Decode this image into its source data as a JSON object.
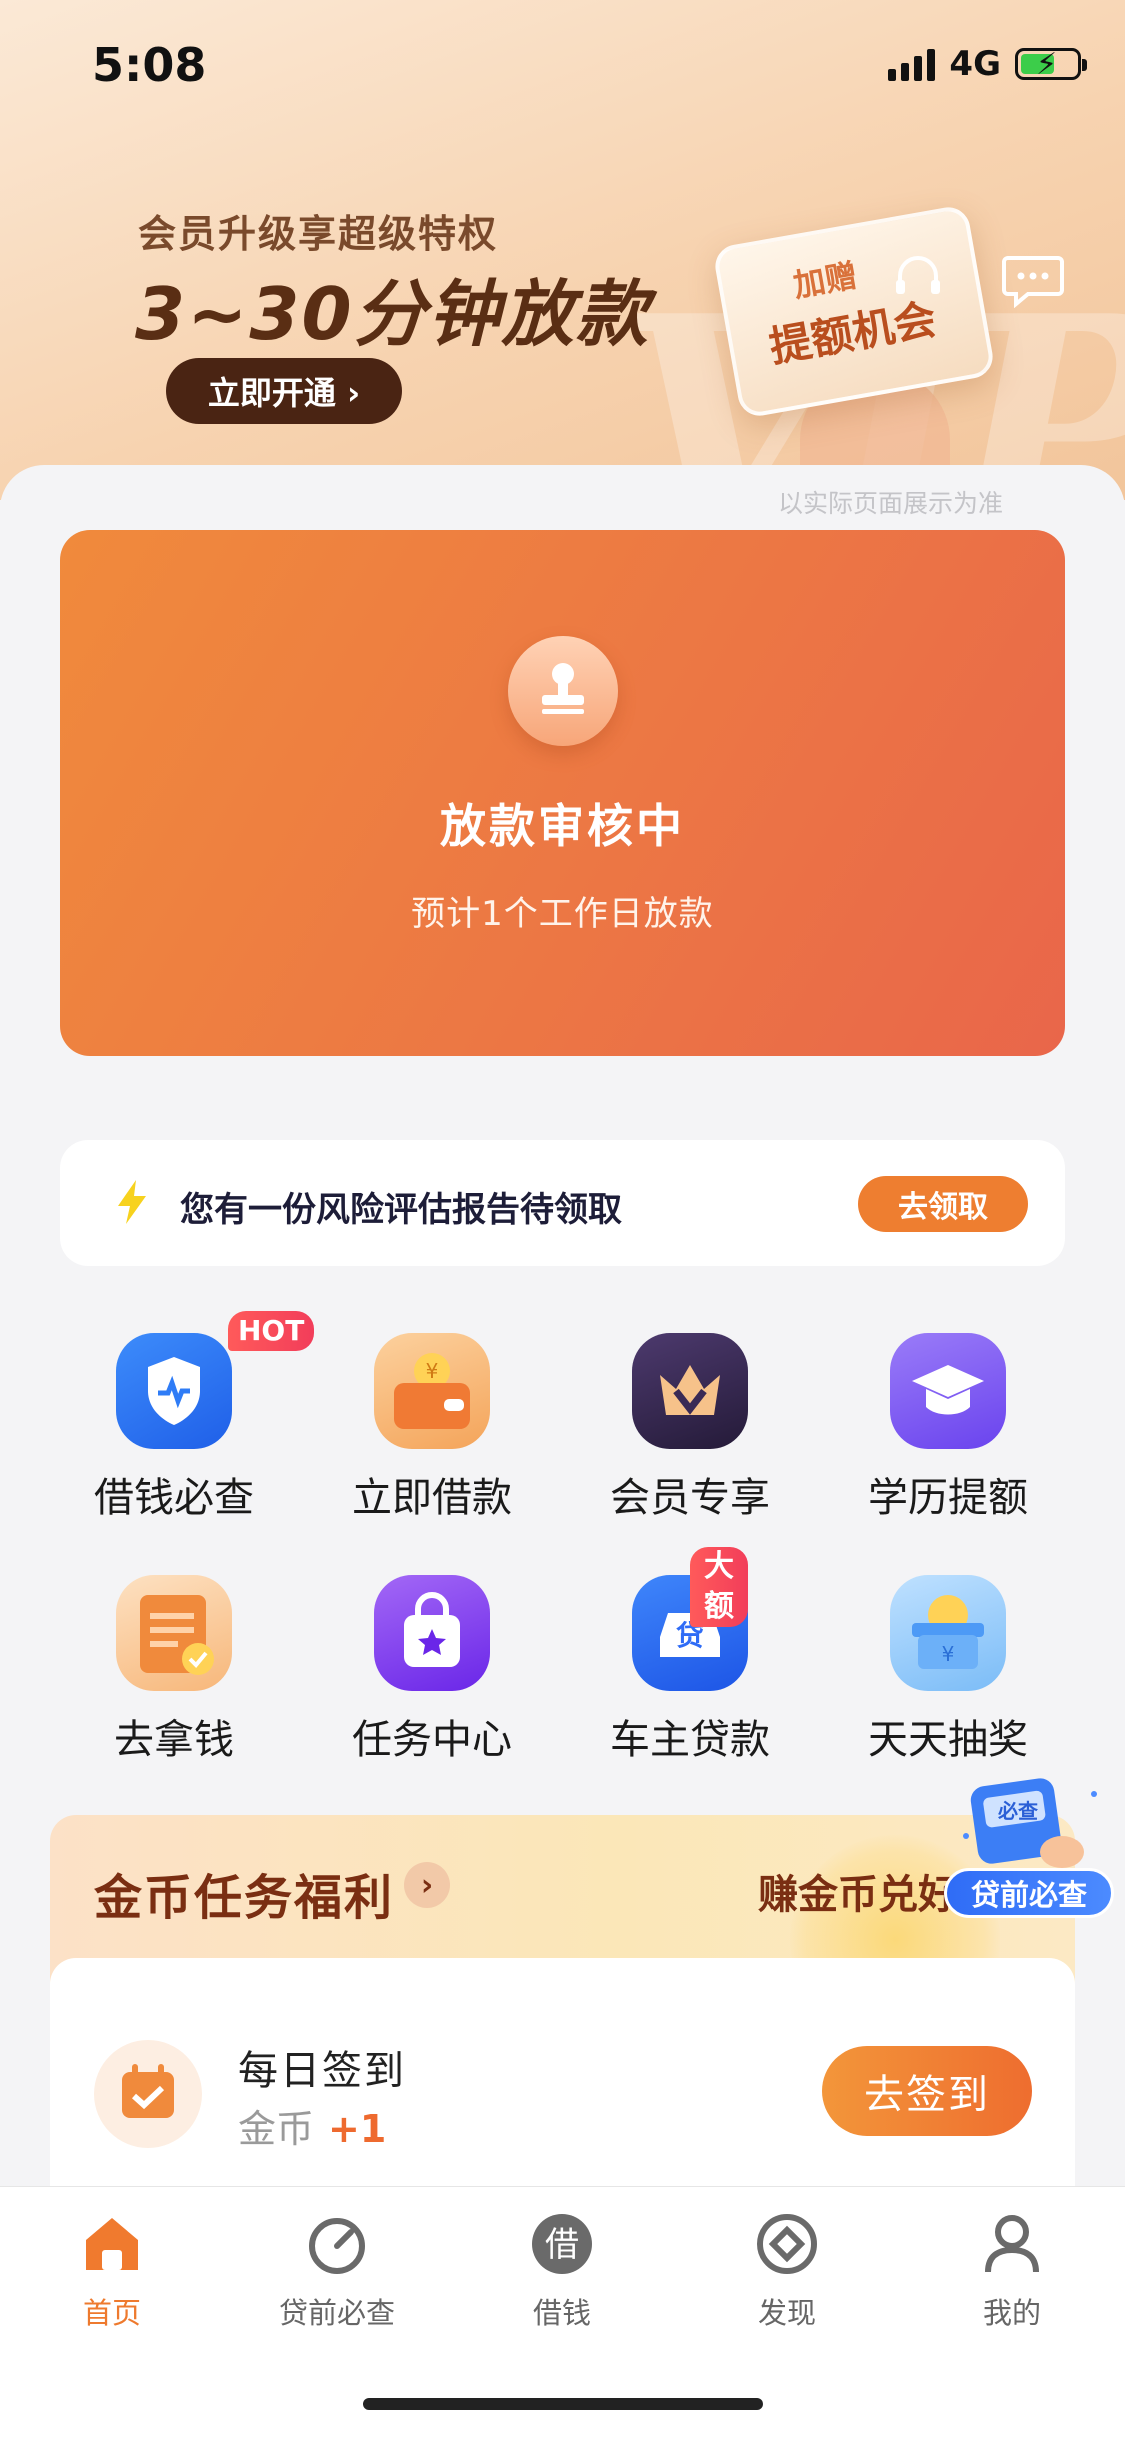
{
  "status_bar": {
    "time": "5:08",
    "network": "4G"
  },
  "hero": {
    "subtitle": "会员升级享超级特权",
    "headline": "3~30分钟放款",
    "cta": "立即开通 ›",
    "card_line1": "加赠",
    "card_line2": "提额机会",
    "watermark": "VIP",
    "disclaimer": "以实际页面展示为准"
  },
  "status_card": {
    "title": "放款审核中",
    "subtitle": "预计1个工作日放款"
  },
  "notice": {
    "text": "您有一份风险评估报告待领取",
    "button": "去领取"
  },
  "services": [
    {
      "label": "借钱必查",
      "badge": "HOT",
      "icon": "shield-icon",
      "color": "#2f7cf6"
    },
    {
      "label": "立即借款",
      "badge": "",
      "icon": "wallet-icon",
      "color": "#f4a45a"
    },
    {
      "label": "会员专享",
      "badge": "",
      "icon": "crown-icon",
      "color": "#3a2a55"
    },
    {
      "label": "学历提额",
      "badge": "",
      "icon": "graduation-cap-icon",
      "color": "#7a5cf3"
    },
    {
      "label": "去拿钱",
      "badge": "",
      "icon": "receipt-icon",
      "color": "#f49a4a"
    },
    {
      "label": "任务中心",
      "badge": "",
      "icon": "shopping-bag-icon",
      "color": "#7a3cf0"
    },
    {
      "label": "车主贷款",
      "badge": "大额",
      "icon": "car-loan-icon",
      "color": "#2f6cf6"
    },
    {
      "label": "天天抽奖",
      "badge": "",
      "icon": "lottery-box-icon",
      "color": "#5aa8f4"
    }
  ],
  "coin_section": {
    "title": "金币任务福利",
    "right_text": "赚金币兑好",
    "task": {
      "title": "每日签到",
      "reward_label": "金币",
      "reward_value": "+1",
      "button": "去签到"
    }
  },
  "float_widget": {
    "label": "贷前必查",
    "card_text": "必查"
  },
  "tabbar": [
    {
      "label": "首页",
      "icon": "home-icon",
      "active": true
    },
    {
      "label": "贷前必查",
      "icon": "gauge-icon",
      "active": false
    },
    {
      "label": "借钱",
      "icon": "borrow-icon",
      "active": false,
      "glyph": "借"
    },
    {
      "label": "发现",
      "icon": "compass-icon",
      "active": false
    },
    {
      "label": "我的",
      "icon": "profile-icon",
      "active": false
    }
  ],
  "colors": {
    "accent": "#ee7a2e",
    "card_gradient_start": "#f08a3c",
    "card_gradient_end": "#e9664a"
  }
}
